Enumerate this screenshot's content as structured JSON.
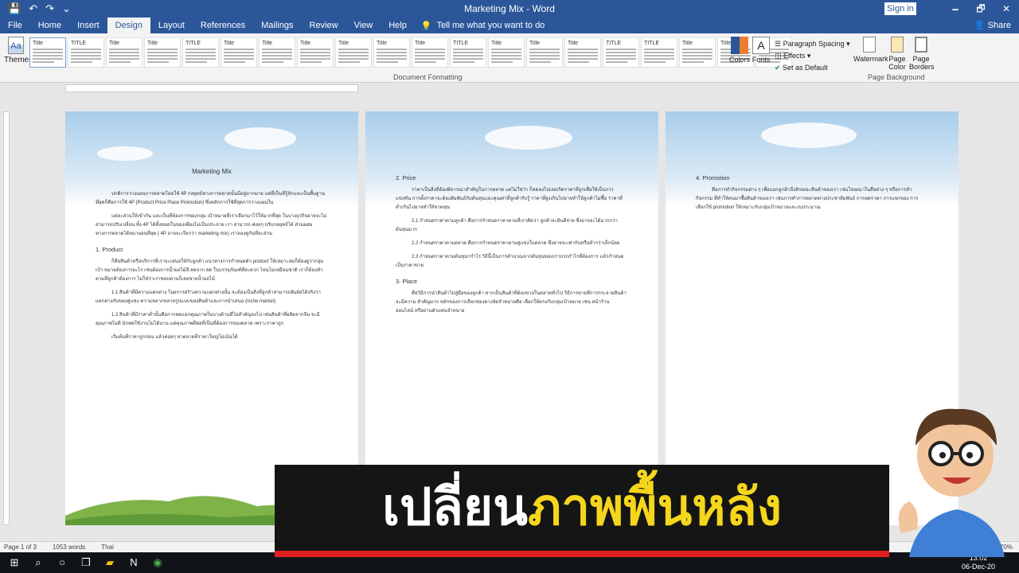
{
  "titlebar": {
    "title": "Marketing Mix - Word",
    "signin": "Sign in",
    "qat": [
      "💾",
      "↶",
      "↷",
      "⌄"
    ],
    "window_controls": [
      "🗕",
      "🗗",
      "✕"
    ]
  },
  "tabs": {
    "items": [
      "File",
      "Home",
      "Insert",
      "Design",
      "Layout",
      "References",
      "Mailings",
      "Review",
      "View",
      "Help"
    ],
    "active": "Design",
    "tellme": "Tell me what you want to do",
    "share": "Share"
  },
  "ribbon": {
    "themes_label": "Themes",
    "style_gallery": [
      "Title",
      "TITLE",
      "Title",
      "Title",
      "TITLE",
      "Title",
      "Title",
      "Title",
      "Title",
      "Title",
      "Title",
      "TITLE",
      "Title",
      "Title",
      "Title",
      "TITLE",
      "TITLE",
      "Title",
      "Title",
      "Title"
    ],
    "document_formatting_label": "Document Formatting",
    "colors_label": "Colors",
    "fonts_label": "Fonts",
    "paragraph_spacing": "Paragraph Spacing ▾",
    "effects": "Effects ▾",
    "set_as_default": "Set as Default",
    "watermark": "Watermark",
    "page_color": "Page\nColor",
    "page_borders": "Page\nBorders",
    "page_background_label": "Page Background"
  },
  "pages": [
    {
      "title": "Marketing Mix",
      "blocks": [
        {
          "type": "p",
          "text": "ปกติการวางแผนการตลาดโดยใช้ 4P กลยุทธ์ทางการตลาดนั้นมีอยู่มากมาย แต่ที่เป็นที่รู้จักและเป็นพื้นฐานที่สุดก็คือการใช้ 4P (Product Price Place Promotion) ซึ่งหลักการใช้ที่สุดการวางแผนใน"
        },
        {
          "type": "p",
          "text": "แต่ละส่วนให้เข้ากัน และเป็นที่ต้องการของกลุ่ม เป้าหมายที่เราเลือกมาไว้ให้มากที่สุด ในบางธุรกิจอาจจะไม่สามารถปรับเปลี่ยน ทั้ง 4P ได้ทั้งหมดในของเพียงไม่เป็นประจาย เรา สามารถ ค่อยๆ ปรับกลยุทธ์ได้ ส่วนผสมทางการตลาดได้หมายอนที่สุด ( 4P อาจจะเรียกว่า marketing mix) เราลองดูกันที่ละส่วน"
        },
        {
          "type": "h",
          "text": "1. Product"
        },
        {
          "type": "p",
          "text": "ก็คือสินค้าหรือบริการที่เราจะเสนอให้กับลูกค้า แนวทางการกำหนดตัว product ให้เหมาะสมก็ต้องดูว่ากลุ่มเป้า หมายต้องการอะไร เช่นต้องการน้ำผลไม้สี สดจาก สด ในบรรจุภัณฑ์ที่สะดวก ไหนไม่เหมือนชาติ เราก็ต้องทำตามที่ลูกค้าต้องการ ไม่ใช่ว่าเราชอบทานก็เลยขายน้ำผลไม้"
        },
        {
          "type": "p",
          "text": "1.1 สินค้าที่มีความแตกต่าง ในยการสร้างความแตกต่างนั้น จะต้องเป็นสิ่งที่ลูกค้าสามารถสัมผัสได้จริงว่าแตกต่างกับของคู่แข่ง ความหลากหลายรูปแบบของสินค้าและการนำเสนอ (niche market)"
        },
        {
          "type": "p",
          "text": "1.2 สินค้าที่มีราคาต่ำนั้นคือการลดแลกคุณภาพในบางด้านที่ไม่สำคัญลงไป เช่นสินค้าที่ผลิตจากจีน จะมีคุณภาพไม่ดี นักทดใช้งานไม่ได้นาน แต่คุณภาพดีพอที่เป็นที่ต้องการของตลาด เพราะราคาถูก"
        },
        {
          "type": "p",
          "text": "เริ่มต้นที่ราคาถูกก่อน แล้วค่อยๆ หาตลาดที่ราคาใหญ่ไม่เน้นได้"
        }
      ]
    },
    {
      "title": "",
      "blocks": [
        {
          "type": "h",
          "text": "2. Price"
        },
        {
          "type": "p",
          "text": "ราคาเป็นสิ่งที่ต้องพิจารณาสำคัญในการตลาด แต่ไม่ใช่ว่า ก็คดลงไปเลยเกิดราคาที่ถูกเพื่อใช้เป็นการแข่งขัน การตั้งราคาจะต้องสัมพันธ์กับต้นทุนและคุณค่าที่ลูกค้ารับรู้ ราคาที่สูงเกินไปอาจทำให้ลูกค้าไม่ซื้อ ราคาที่ต่ำเกินไปอาจทำให้ขาดทุน"
        },
        {
          "type": "p",
          "text": "2.1 กำหนดราคาตามลูกค้า คือการกำหนดราคาตามที่เราคิดว่า ลูกค้าจะยินดีจ่าย ซึ่งอาจจะได้มากกว่าต้นทุนมาก"
        },
        {
          "type": "p",
          "text": "2.2 กำหนดราคาตามตลาด คือการกำหนดราคาตามคู่แข่งในตลาด ซึ่งอาจจะเท่ากันหรือต่ำกว่าเล็กน้อย"
        },
        {
          "type": "p",
          "text": "2.3 กำหนดราคาตามต้นทุน+กำไร วิธีนี้เป็นการคำนวณจากต้นทุนของเราบวกกำไรที่ต้องการ แล้วกำหนดเป็นราคาขาย"
        },
        {
          "type": "h",
          "text": "3. Place"
        },
        {
          "type": "p",
          "text": "คือวิธีการนำสินค้าไปสู่มือของลูกค้า หากเป็นสินค้าที่ต้องขายในตลาดทั่วไป วิธีการขายที่การกระจายสินค้าจะมีความ สำคัญมาก หลักของการเลือกช่องทางจัดจำหน่ายคือ เลือกให้ตรงกับกลุ่มเป้าหมาย เช่น หน้าร้าน ออนไลน์ หรือผ่านตัวแทนจำหน่าย"
        }
      ]
    },
    {
      "title": "",
      "blocks": [
        {
          "type": "h",
          "text": "4. Promotion"
        },
        {
          "type": "p",
          "text": "คือการทำกิจกรรมต่าง ๆ เพื่อบอกลูกค้าถึงลักษณะสินค้าของเรา เช่นโฆษณาในสื่อต่าง ๆ หรือการทำกิจกรรม ที่ทำให้คนมาซื้อสินค้าของเรา เช่นการทำการตลาดทางประชาสัมพันธ์ การลดราคา การแจกของ การเลือกใช้ promotion ให้เหมาะกับกลุ่มเป้าหมายและงบประมาณ"
        }
      ]
    }
  ],
  "statusbar": {
    "page": "Page 1 of 3",
    "words": "1053 words",
    "language": "Thai",
    "zoom": "70%"
  },
  "taskbar": {
    "time": "13:02",
    "date": "06-Dec-20"
  },
  "banner": {
    "part1": "เปลี่ยน",
    "part2": "ภาพพื้นหลัง"
  },
  "colors": {
    "word_blue": "#2b579a",
    "banner_bg": "#151515",
    "banner_yellow": "#f5d61c",
    "banner_red": "#e02020"
  }
}
